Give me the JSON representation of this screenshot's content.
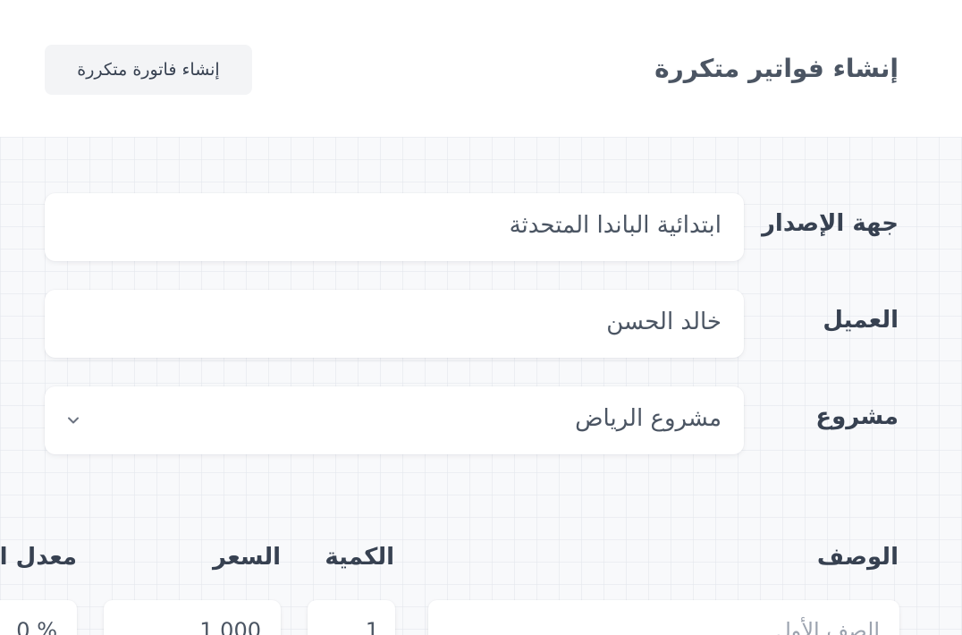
{
  "header": {
    "title": "إنشاء فواتير متكررة",
    "create_button_label": "إنشاء فاتورة متكررة"
  },
  "form": {
    "issuer": {
      "label": "جهة الإصدار",
      "value": "ابتدائية الباندا المتحدثة"
    },
    "client": {
      "label": "العميل",
      "value": "خالد الحسن"
    },
    "project": {
      "label": "مشروع",
      "value": "مشروع الرياض",
      "icon": "chevron-down-icon"
    }
  },
  "items_table": {
    "columns": {
      "description": "الوصف",
      "quantity": "الكمية",
      "price": "السعر",
      "tax_rate": "معدل ال"
    },
    "rows": [
      {
        "description_placeholder": "الصف الأول",
        "quantity": "1",
        "price": "1,000",
        "tax_rate": "0 %"
      }
    ]
  },
  "colors": {
    "background": "#f8f9fb",
    "card": "#ffffff",
    "text": "#374151",
    "button_bg": "#f3f4f6"
  }
}
